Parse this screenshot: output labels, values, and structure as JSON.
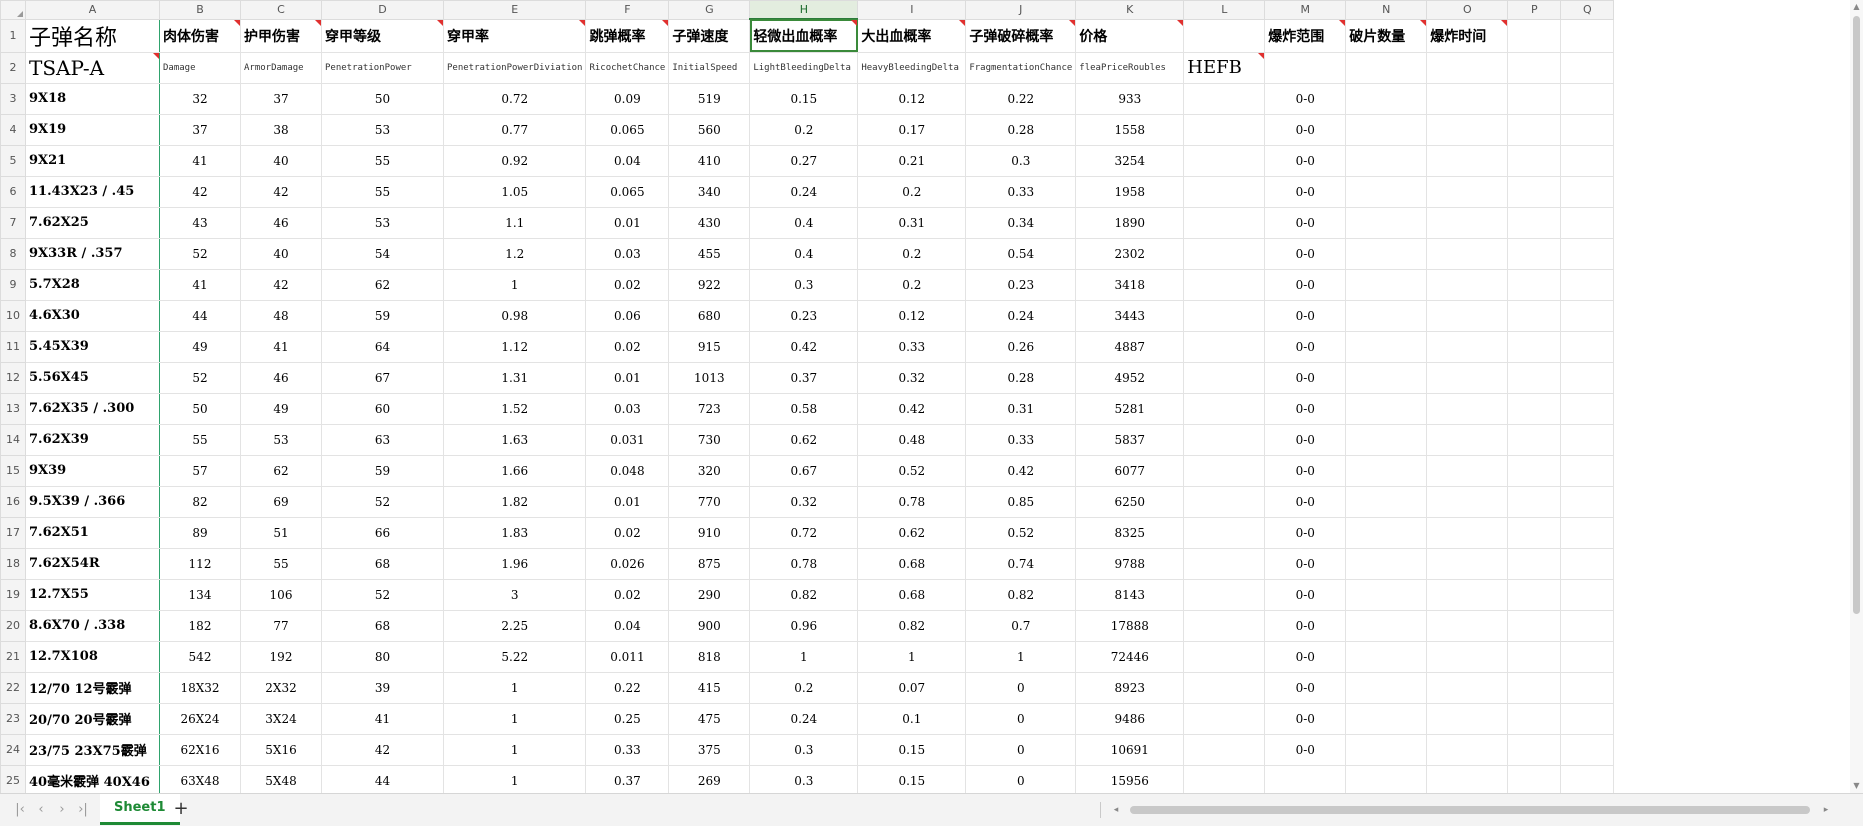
{
  "sheet": {
    "selected_cell": "H1",
    "column_letters": [
      "A",
      "B",
      "C",
      "D",
      "E",
      "F",
      "G",
      "H",
      "I",
      "J",
      "K",
      "L",
      "M",
      "N",
      "O",
      "P",
      "Q"
    ],
    "commented_columns": [
      "B",
      "C",
      "D",
      "E",
      "F",
      "H",
      "I",
      "J",
      "K",
      "M",
      "N",
      "O"
    ],
    "comment_color": "#e0302f",
    "accent_color": "#1e8a35",
    "header_row": {
      "A": "子弹名称",
      "B": "肉体伤害",
      "C": "护甲伤害",
      "D": "穿甲等级",
      "E": "穿甲率",
      "F": "跳弹概率",
      "G": "子弹速度",
      "H": "轻微出血概率",
      "I": "大出血概率",
      "J": "子弹破碎概率",
      "K": "价格",
      "L": "",
      "M": "爆炸范围",
      "N": "破片数量",
      "O": "爆炸时间",
      "P": "",
      "Q": ""
    },
    "sub_header_row": {
      "A": "TSAP-A",
      "B": "Damage",
      "C": "ArmorDamage",
      "D": "PenetrationPower",
      "E": "PenetrationPowerDiviation",
      "F": "RicochetChance",
      "G": "InitialSpeed",
      "H": "LightBleedingDelta",
      "I": "HeavyBleedingDelta",
      "J": "FragmentationChance",
      "K": "fleaPriceRoubles",
      "L": "HEFB",
      "M": "",
      "N": "",
      "O": "",
      "P": "",
      "Q": ""
    },
    "data_rows": [
      {
        "num": 3,
        "A": "9X18",
        "B": "32",
        "C": "37",
        "D": "50",
        "E": "0.72",
        "F": "0.09",
        "G": "519",
        "H": "0.15",
        "I": "0.12",
        "J": "0.22",
        "K": "933",
        "M": "0-0"
      },
      {
        "num": 4,
        "A": "9X19",
        "B": "37",
        "C": "38",
        "D": "53",
        "E": "0.77",
        "F": "0.065",
        "G": "560",
        "H": "0.2",
        "I": "0.17",
        "J": "0.28",
        "K": "1558",
        "M": "0-0"
      },
      {
        "num": 5,
        "A": "9X21",
        "B": "41",
        "C": "40",
        "D": "55",
        "E": "0.92",
        "F": "0.04",
        "G": "410",
        "H": "0.27",
        "I": "0.21",
        "J": "0.3",
        "K": "3254",
        "M": "0-0"
      },
      {
        "num": 6,
        "A": "11.43X23 / .45",
        "B": "42",
        "C": "42",
        "D": "55",
        "E": "1.05",
        "F": "0.065",
        "G": "340",
        "H": "0.24",
        "I": "0.2",
        "J": "0.33",
        "K": "1958",
        "M": "0-0"
      },
      {
        "num": 7,
        "A": "7.62X25",
        "B": "43",
        "C": "46",
        "D": "53",
        "E": "1.1",
        "F": "0.01",
        "G": "430",
        "H": "0.4",
        "I": "0.31",
        "J": "0.34",
        "K": "1890",
        "M": "0-0"
      },
      {
        "num": 8,
        "A": "9X33R / .357",
        "B": "52",
        "C": "40",
        "D": "54",
        "E": "1.2",
        "F": "0.03",
        "G": "455",
        "H": "0.4",
        "I": "0.2",
        "J": "0.54",
        "K": "2302",
        "M": "0-0"
      },
      {
        "num": 9,
        "A": "5.7X28",
        "B": "41",
        "C": "42",
        "D": "62",
        "E": "1",
        "F": "0.02",
        "G": "922",
        "H": "0.3",
        "I": "0.2",
        "J": "0.23",
        "K": "3418",
        "M": "0-0"
      },
      {
        "num": 10,
        "A": "4.6X30",
        "B": "44",
        "C": "48",
        "D": "59",
        "E": "0.98",
        "F": "0.06",
        "G": "680",
        "H": "0.23",
        "I": "0.12",
        "J": "0.24",
        "K": "3443",
        "M": "0-0"
      },
      {
        "num": 11,
        "A": "5.45X39",
        "B": "49",
        "C": "41",
        "D": "64",
        "E": "1.12",
        "F": "0.02",
        "G": "915",
        "H": "0.42",
        "I": "0.33",
        "J": "0.26",
        "K": "4887",
        "M": "0-0"
      },
      {
        "num": 12,
        "A": "5.56X45",
        "B": "52",
        "C": "46",
        "D": "67",
        "E": "1.31",
        "F": "0.01",
        "G": "1013",
        "H": "0.37",
        "I": "0.32",
        "J": "0.28",
        "K": "4952",
        "M": "0-0"
      },
      {
        "num": 13,
        "A": "7.62X35 / .300",
        "B": "50",
        "C": "49",
        "D": "60",
        "E": "1.52",
        "F": "0.03",
        "G": "723",
        "H": "0.58",
        "I": "0.42",
        "J": "0.31",
        "K": "5281",
        "M": "0-0"
      },
      {
        "num": 14,
        "A": "7.62X39",
        "B": "55",
        "C": "53",
        "D": "63",
        "E": "1.63",
        "F": "0.031",
        "G": "730",
        "H": "0.62",
        "I": "0.48",
        "J": "0.33",
        "K": "5837",
        "M": "0-0"
      },
      {
        "num": 15,
        "A": "9X39",
        "B": "57",
        "C": "62",
        "D": "59",
        "E": "1.66",
        "F": "0.048",
        "G": "320",
        "H": "0.67",
        "I": "0.52",
        "J": "0.42",
        "K": "6077",
        "M": "0-0"
      },
      {
        "num": 16,
        "A": "9.5X39 / .366",
        "B": "82",
        "C": "69",
        "D": "52",
        "E": "1.82",
        "F": "0.01",
        "G": "770",
        "H": "0.32",
        "I": "0.78",
        "J": "0.85",
        "K": "6250",
        "M": "0-0"
      },
      {
        "num": 17,
        "A": "7.62X51",
        "B": "89",
        "C": "51",
        "D": "66",
        "E": "1.83",
        "F": "0.02",
        "G": "910",
        "H": "0.72",
        "I": "0.62",
        "J": "0.52",
        "K": "8325",
        "M": "0-0"
      },
      {
        "num": 18,
        "A": "7.62X54R",
        "B": "112",
        "C": "55",
        "D": "68",
        "E": "1.96",
        "F": "0.026",
        "G": "875",
        "H": "0.78",
        "I": "0.68",
        "J": "0.74",
        "K": "9788",
        "M": "0-0"
      },
      {
        "num": 19,
        "A": "12.7X55",
        "B": "134",
        "C": "106",
        "D": "52",
        "E": "3",
        "F": "0.02",
        "G": "290",
        "H": "0.82",
        "I": "0.68",
        "J": "0.82",
        "K": "8143",
        "M": "0-0"
      },
      {
        "num": 20,
        "A": "8.6X70 / .338",
        "B": "182",
        "C": "77",
        "D": "68",
        "E": "2.25",
        "F": "0.04",
        "G": "900",
        "H": "0.96",
        "I": "0.82",
        "J": "0.7",
        "K": "17888",
        "M": "0-0"
      },
      {
        "num": 21,
        "A": "12.7X108",
        "B": "542",
        "C": "192",
        "D": "80",
        "E": "5.22",
        "F": "0.011",
        "G": "818",
        "H": "1",
        "I": "1",
        "J": "1",
        "K": "72446",
        "M": "0-0"
      },
      {
        "num": 22,
        "A": "12/70 12号霰弹",
        "B": "18X32",
        "C": "2X32",
        "D": "39",
        "E": "1",
        "F": "0.22",
        "G": "415",
        "H": "0.2",
        "I": "0.07",
        "J": "0",
        "K": "8923",
        "M": "0-0"
      },
      {
        "num": 23,
        "A": "20/70 20号霰弹",
        "B": "26X24",
        "C": "3X24",
        "D": "41",
        "E": "1",
        "F": "0.25",
        "G": "475",
        "H": "0.24",
        "I": "0.1",
        "J": "0",
        "K": "9486",
        "M": "0-0"
      },
      {
        "num": 24,
        "A": "23/75 23X75霰弹",
        "B": "62X16",
        "C": "5X16",
        "D": "42",
        "E": "1",
        "F": "0.33",
        "G": "375",
        "H": "0.3",
        "I": "0.15",
        "J": "0",
        "K": "10691",
        "M": "0-0"
      },
      {
        "num": 25,
        "A": "40毫米霰弹 40X46",
        "B": "63X48",
        "C": "5X48",
        "D": "44",
        "E": "1",
        "F": "0.37",
        "G": "269",
        "H": "0.3",
        "I": "0.15",
        "J": "0",
        "K": "15956",
        "M": ""
      }
    ]
  },
  "tabs": {
    "active_sheet": "Sheet1",
    "add_symbol": "+"
  },
  "nav": {
    "first": "|‹",
    "prev": "‹",
    "next": "›",
    "last": "›|"
  },
  "scroll": {
    "up": "▲",
    "down": "▼",
    "left": "◂",
    "right": "▸"
  }
}
